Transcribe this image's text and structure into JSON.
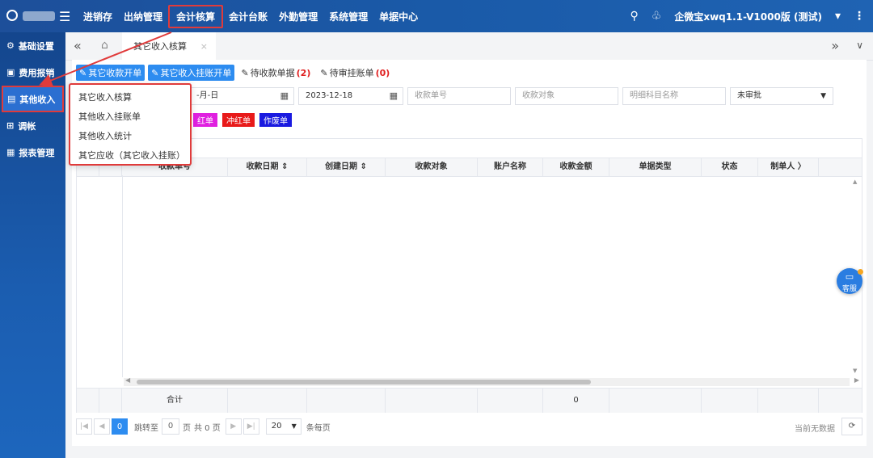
{
  "topbar": {
    "menu": [
      "进销存",
      "出纳管理",
      "会计核算",
      "会计台账",
      "外勤管理",
      "系统管理",
      "单据中心"
    ],
    "active_index": 2,
    "account": "企微宝xwq1.1-V1000版 (测试)",
    "search_icon": "search-icon",
    "bell_icon": "bell-icon"
  },
  "sidebar": {
    "items": [
      {
        "label": "基础设置",
        "icon": "gear-icon"
      },
      {
        "label": "费用报销",
        "icon": "receipt-icon"
      },
      {
        "label": "其他收入",
        "icon": "income-icon"
      },
      {
        "label": "调帐",
        "icon": "adjust-icon"
      },
      {
        "label": "报表管理",
        "icon": "report-icon"
      }
    ],
    "active_index": 2
  },
  "tabs": {
    "active": "其它收入核算"
  },
  "toolbar": {
    "btn1": "其它收款开单",
    "btn2": "其它收入挂账开单",
    "btn3": "待收款单据",
    "btn3_count": "(2)",
    "btn4": "待审挂账单",
    "btn4_count": "(0)"
  },
  "filters": {
    "date_start": "-月-日",
    "date_end": "2023-12-18",
    "receipt_no": "收款单号",
    "payer": "收款对象",
    "detail_subject": "明细科目名称",
    "status": "未审批"
  },
  "tags": [
    {
      "label": "红单",
      "color": "#e020e0"
    },
    {
      "label": "冲红单",
      "color": "#e81a1a"
    },
    {
      "label": "作废单",
      "color": "#1a1ae0"
    }
  ],
  "table": {
    "columns": [
      "收款单号",
      "收款日期",
      "创建日期",
      "收款对象",
      "账户名称",
      "收款金额",
      "单据类型",
      "状态",
      "制单人"
    ],
    "sort_columns": [
      "收款日期",
      "创建日期"
    ],
    "footer_label": "合计",
    "footer_amount": "0"
  },
  "pager": {
    "current_page": "0",
    "goto_label": "跳转至",
    "goto_value": "0",
    "page_label": "页",
    "total_label": "共 0 页",
    "page_size": "20",
    "per_page_label": "条每页",
    "no_data": "当前无数据"
  },
  "dropdown": {
    "items": [
      "其它收入核算",
      "其他收入挂账单",
      "其他收入统计",
      "其它应收（其它收入挂账）"
    ]
  },
  "service": {
    "label": "客服"
  }
}
